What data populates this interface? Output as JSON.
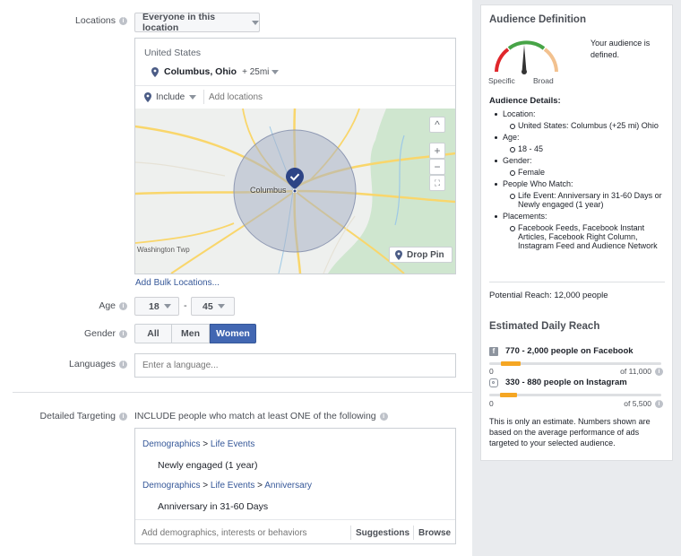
{
  "locations": {
    "label": "Locations",
    "scope_dropdown": "Everyone in this location",
    "country": "United States",
    "city": "Columbus, Ohio",
    "radius": "+ 25mi",
    "include_label": "Include",
    "add_placeholder": "Add locations",
    "map_city_label": "Columbus",
    "map_town_label": "Washington Twp",
    "drop_pin": "Drop Pin",
    "bulk_link": "Add Bulk Locations..."
  },
  "map_controls": {
    "up": "^",
    "zoom_in": "+",
    "zoom_out": "−",
    "fullscreen": "⛶"
  },
  "age": {
    "label": "Age",
    "min": "18",
    "separator": "-",
    "max": "45"
  },
  "gender": {
    "label": "Gender",
    "options": [
      "All",
      "Men",
      "Women"
    ],
    "selected": "Women"
  },
  "languages": {
    "label": "Languages",
    "placeholder": "Enter a language..."
  },
  "detailed": {
    "label": "Detailed Targeting",
    "intro": "INCLUDE people who match at least ONE of the following",
    "groups": [
      {
        "crumbs": [
          "Demographics",
          ">",
          "Life Events"
        ],
        "item": "Newly engaged (1 year)"
      },
      {
        "crumbs": [
          "Demographics",
          ">",
          "Life Events",
          ">",
          "Anniversary"
        ],
        "item": "Anniversary in 31-60 Days"
      }
    ],
    "placeholder": "Add demographics, interests or behaviors",
    "suggestions": "Suggestions",
    "browse": "Browse"
  },
  "audience": {
    "title": "Audience Definition",
    "gauge_specific": "Specific",
    "gauge_broad": "Broad",
    "gauge_level": 0.5,
    "status": "Your audience is defined.",
    "details_title": "Audience Details:",
    "details": [
      {
        "label": "Location:",
        "values": [
          "United States: Columbus (+25 mi) Ohio"
        ]
      },
      {
        "label": "Age:",
        "values": [
          "18 - 45"
        ]
      },
      {
        "label": "Gender:",
        "values": [
          "Female"
        ]
      },
      {
        "label": "People Who Match:",
        "values": [
          "Life Event: Anniversary in 31-60 Days or Newly engaged (1 year)"
        ]
      },
      {
        "label": "Placements:",
        "values": [
          "Facebook Feeds, Facebook Instant Articles, Facebook Right Column, Instagram Feed and Audience Network"
        ]
      }
    ],
    "potential_reach": "Potential Reach: 12,000 people"
  },
  "daily_reach": {
    "title": "Estimated Daily Reach",
    "facebook": {
      "text": "770 - 2,000 people on Facebook",
      "min": "0",
      "max": "of 11,000",
      "low": 770,
      "high": 2000,
      "total": 11000
    },
    "instagram": {
      "text": "330 - 880 people on Instagram",
      "min": "0",
      "max": "of 5,500",
      "low": 330,
      "high": 880,
      "total": 5500
    },
    "note": "This is only an estimate. Numbers shown are based on the average performance of ads targeted to your selected audience."
  },
  "colors": {
    "accent": "#4267b2",
    "link": "#365899",
    "bar": "#f5a623",
    "map_land": "#eef0ee",
    "map_road": "#f9d66b",
    "map_green": "#cfe6cf"
  }
}
